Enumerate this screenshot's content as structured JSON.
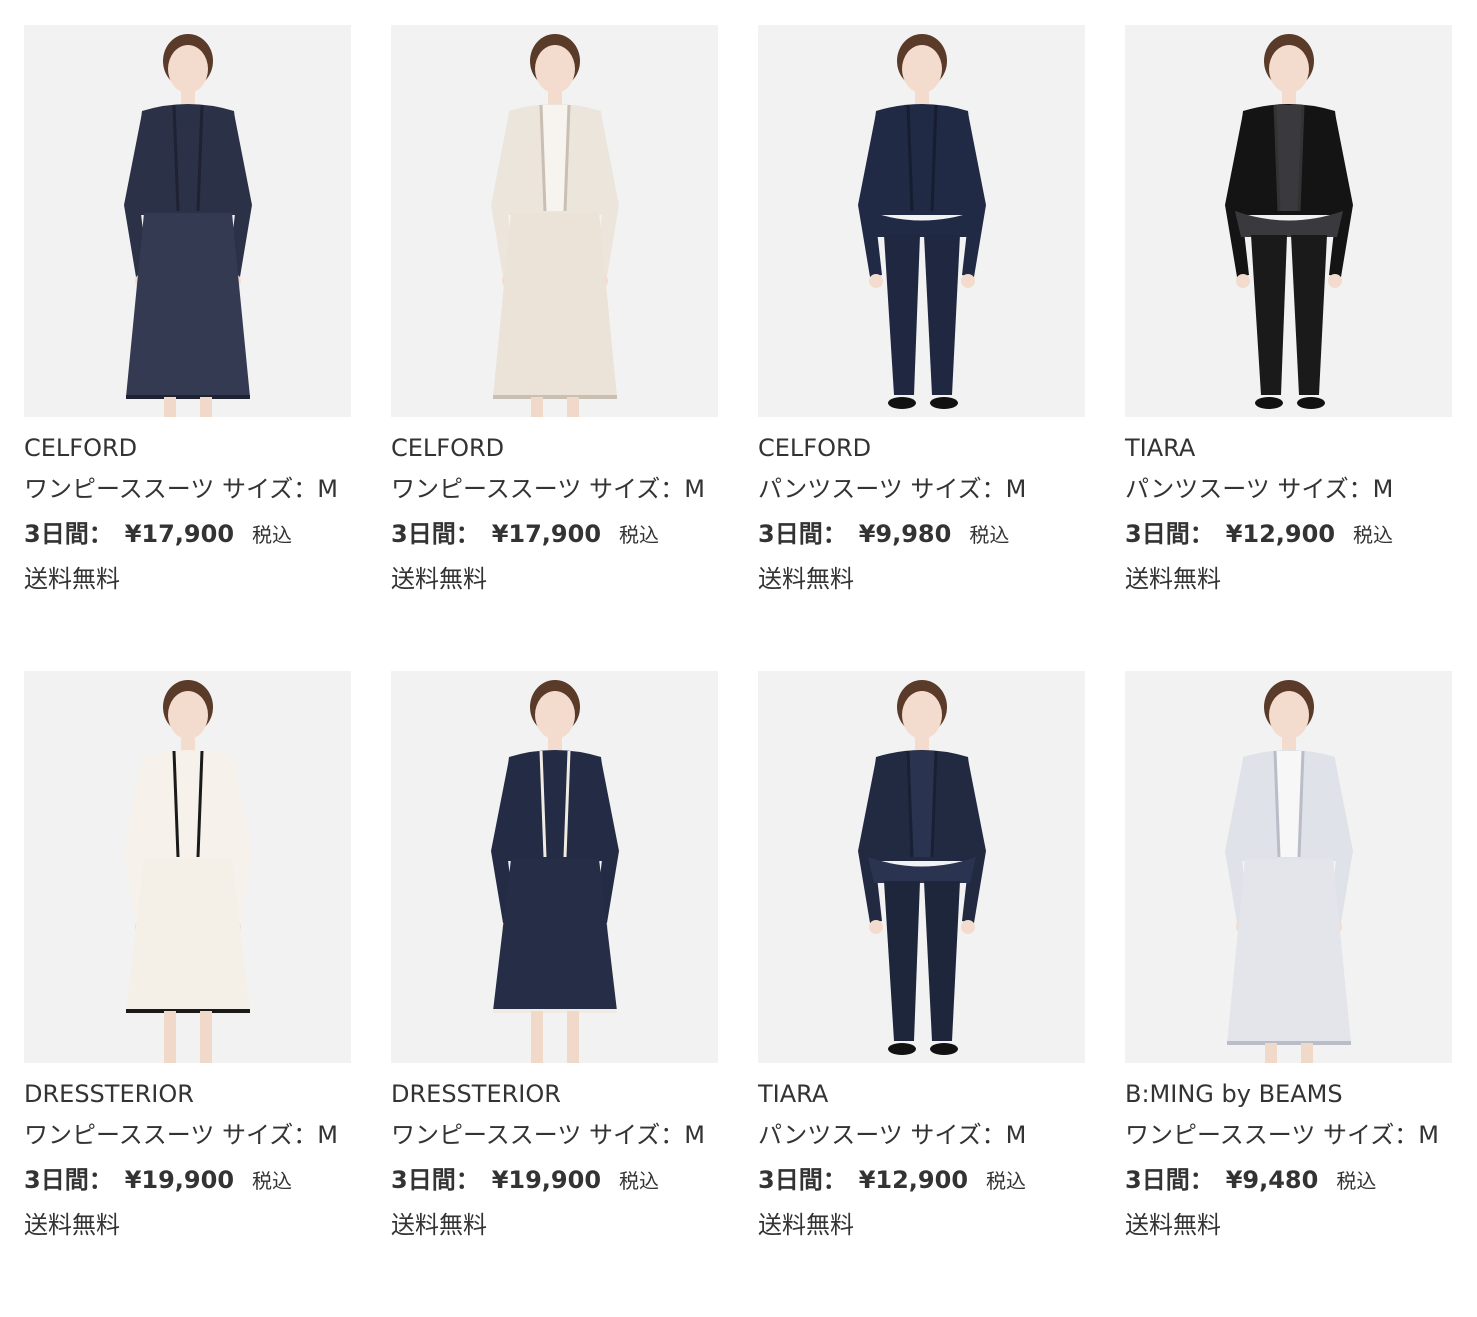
{
  "products": [
    {
      "brand": "CELFORD",
      "desc": "ワンピーススーツ サイズ：M",
      "period": "3日間：",
      "price": "¥17,900",
      "tax": "税込",
      "shipping": "送料無料",
      "colors": {
        "top": "#2b3146",
        "bottom": "#333a52",
        "inner": "#2b3146",
        "trim": "#1e2233",
        "legs": "#f1d9c9",
        "style": "skirt"
      }
    },
    {
      "brand": "CELFORD",
      "desc": "ワンピーススーツ サイズ：M",
      "period": "3日間：",
      "price": "¥17,900",
      "tax": "税込",
      "shipping": "送料無料",
      "colors": {
        "top": "#ece5dc",
        "bottom": "#ebe2d8",
        "inner": "#f7f4ef",
        "trim": "#c9bfb2",
        "legs": "#f1d9c9",
        "style": "skirt"
      }
    },
    {
      "brand": "CELFORD",
      "desc": "パンツスーツ サイズ：M",
      "period": "3日間：",
      "price": "¥9,980",
      "tax": "税込",
      "shipping": "送料無料",
      "colors": {
        "top": "#202a44",
        "bottom": "#1f2840",
        "inner": "#202a44",
        "trim": "#161d30",
        "legs": "#1f2840",
        "style": "pants"
      }
    },
    {
      "brand": "TIARA",
      "desc": "パンツスーツ サイズ：M",
      "period": "3日間：",
      "price": "¥12,900",
      "tax": "税込",
      "shipping": "送料無料",
      "colors": {
        "top": "#141414",
        "bottom": "#1a1a1a",
        "inner": "#3a3a3e",
        "trim": "#333333",
        "legs": "#1a1a1a",
        "style": "pants"
      }
    },
    {
      "brand": "DRESSTERIOR",
      "desc": "ワンピーススーツ サイズ：M",
      "period": "3日間：",
      "price": "¥19,900",
      "tax": "税込",
      "shipping": "送料無料",
      "colors": {
        "top": "#f6f1ea",
        "bottom": "#f4efe7",
        "inner": "#f6f1ea",
        "trim": "#1a1a1a",
        "legs": "#f1d9c9",
        "style": "dress"
      }
    },
    {
      "brand": "DRESSTERIOR",
      "desc": "ワンピーススーツ サイズ：M",
      "period": "3日間：",
      "price": "¥19,900",
      "tax": "税込",
      "shipping": "送料無料",
      "colors": {
        "top": "#232b45",
        "bottom": "#252d47",
        "inner": "#232b45",
        "trim": "#f0ebe3",
        "legs": "#f1d9c9",
        "style": "dress"
      }
    },
    {
      "brand": "TIARA",
      "desc": "パンツスーツ サイズ：M",
      "period": "3日間：",
      "price": "¥12,900",
      "tax": "税込",
      "shipping": "送料無料",
      "colors": {
        "top": "#222a42",
        "bottom": "#1e263c",
        "inner": "#2a3350",
        "trim": "#1a2033",
        "legs": "#1e263c",
        "style": "pants"
      }
    },
    {
      "brand": "B:MING by BEAMS",
      "desc": "ワンピーススーツ サイズ：M",
      "period": "3日間：",
      "price": "¥9,480",
      "tax": "税込",
      "shipping": "送料無料",
      "colors": {
        "top": "#dfe2e8",
        "bottom": "#e3e5ea",
        "inner": "#f7f7f7",
        "trim": "#b9bdc8",
        "legs": "#f1d9c9",
        "style": "skirt"
      }
    }
  ]
}
